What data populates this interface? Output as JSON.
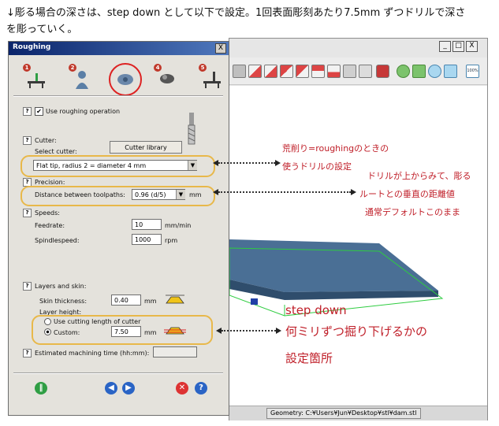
{
  "intro": {
    "line1": "↓彫る場合の深さは、step down として以下で設定。1回表面彫刻あたり7.5mm ずつドリルで深さ",
    "line2": "を彫っていく。"
  },
  "app": {
    "window_controls": [
      "_",
      "□",
      "X"
    ],
    "toolbar_zoom": "100%",
    "status_geometry": "Geometry: C:¥Users¥Jun¥Desktop¥stl¥dam.stl"
  },
  "dialog": {
    "title": "Roughing",
    "close": "X",
    "steps": [
      "1",
      "2",
      "3",
      "4",
      "5"
    ],
    "help_mark": "?",
    "use_roughing": {
      "label": "Use roughing operation",
      "checked": true,
      "mark": "✔"
    },
    "cutter": {
      "heading": "Cutter:",
      "select_label": "Select cutter:",
      "library_button": "Cutter library",
      "value": "Flat tip, radius 2 = diameter 4 mm"
    },
    "precision": {
      "heading": "Precision:",
      "distance_label": "Distance between toolpaths:",
      "distance_value": "0.96  (d/5)",
      "unit": "mm"
    },
    "speeds": {
      "heading": "Speeds:",
      "feedrate_label": "Feedrate:",
      "feedrate_value": "10",
      "feedrate_unit": "mm/min",
      "spindle_label": "Spindlespeed:",
      "spindle_value": "1000",
      "spindle_unit": "rpm"
    },
    "layers": {
      "heading": "Layers and skin:",
      "skin_label": "Skin thickness:",
      "skin_value": "0.40",
      "skin_unit": "mm",
      "layer_height_label": "Layer height:",
      "use_cutting_length": "Use cutting length of cutter",
      "custom_label": "Custom:",
      "custom_value": "7.50",
      "custom_unit": "mm"
    },
    "estimated": {
      "label": "Estimated machining time (hh:mm):",
      "value": ""
    },
    "footer_icons": [
      "go-icon",
      "back-icon",
      "next-icon",
      "cancel-icon",
      "help-icon"
    ]
  },
  "annotations": {
    "cutter_note_1": "荒削り=roughingのときの",
    "cutter_note_2": "使うドリルの設定",
    "precision_note_1": "ドリルが上からみて、彫る",
    "precision_note_2": "ルートとの垂直の距離値",
    "precision_note_3": "通常デフォルトこのまま",
    "stepdown_1": "step down",
    "stepdown_2": "何ミリずつ掘り下げるかの",
    "stepdown_3": "設定箇所"
  },
  "colors": {
    "annotation": "#c0202a",
    "highlight": "#e8b84a",
    "titlebar": "#0a246a",
    "model": "#4a6f95"
  }
}
